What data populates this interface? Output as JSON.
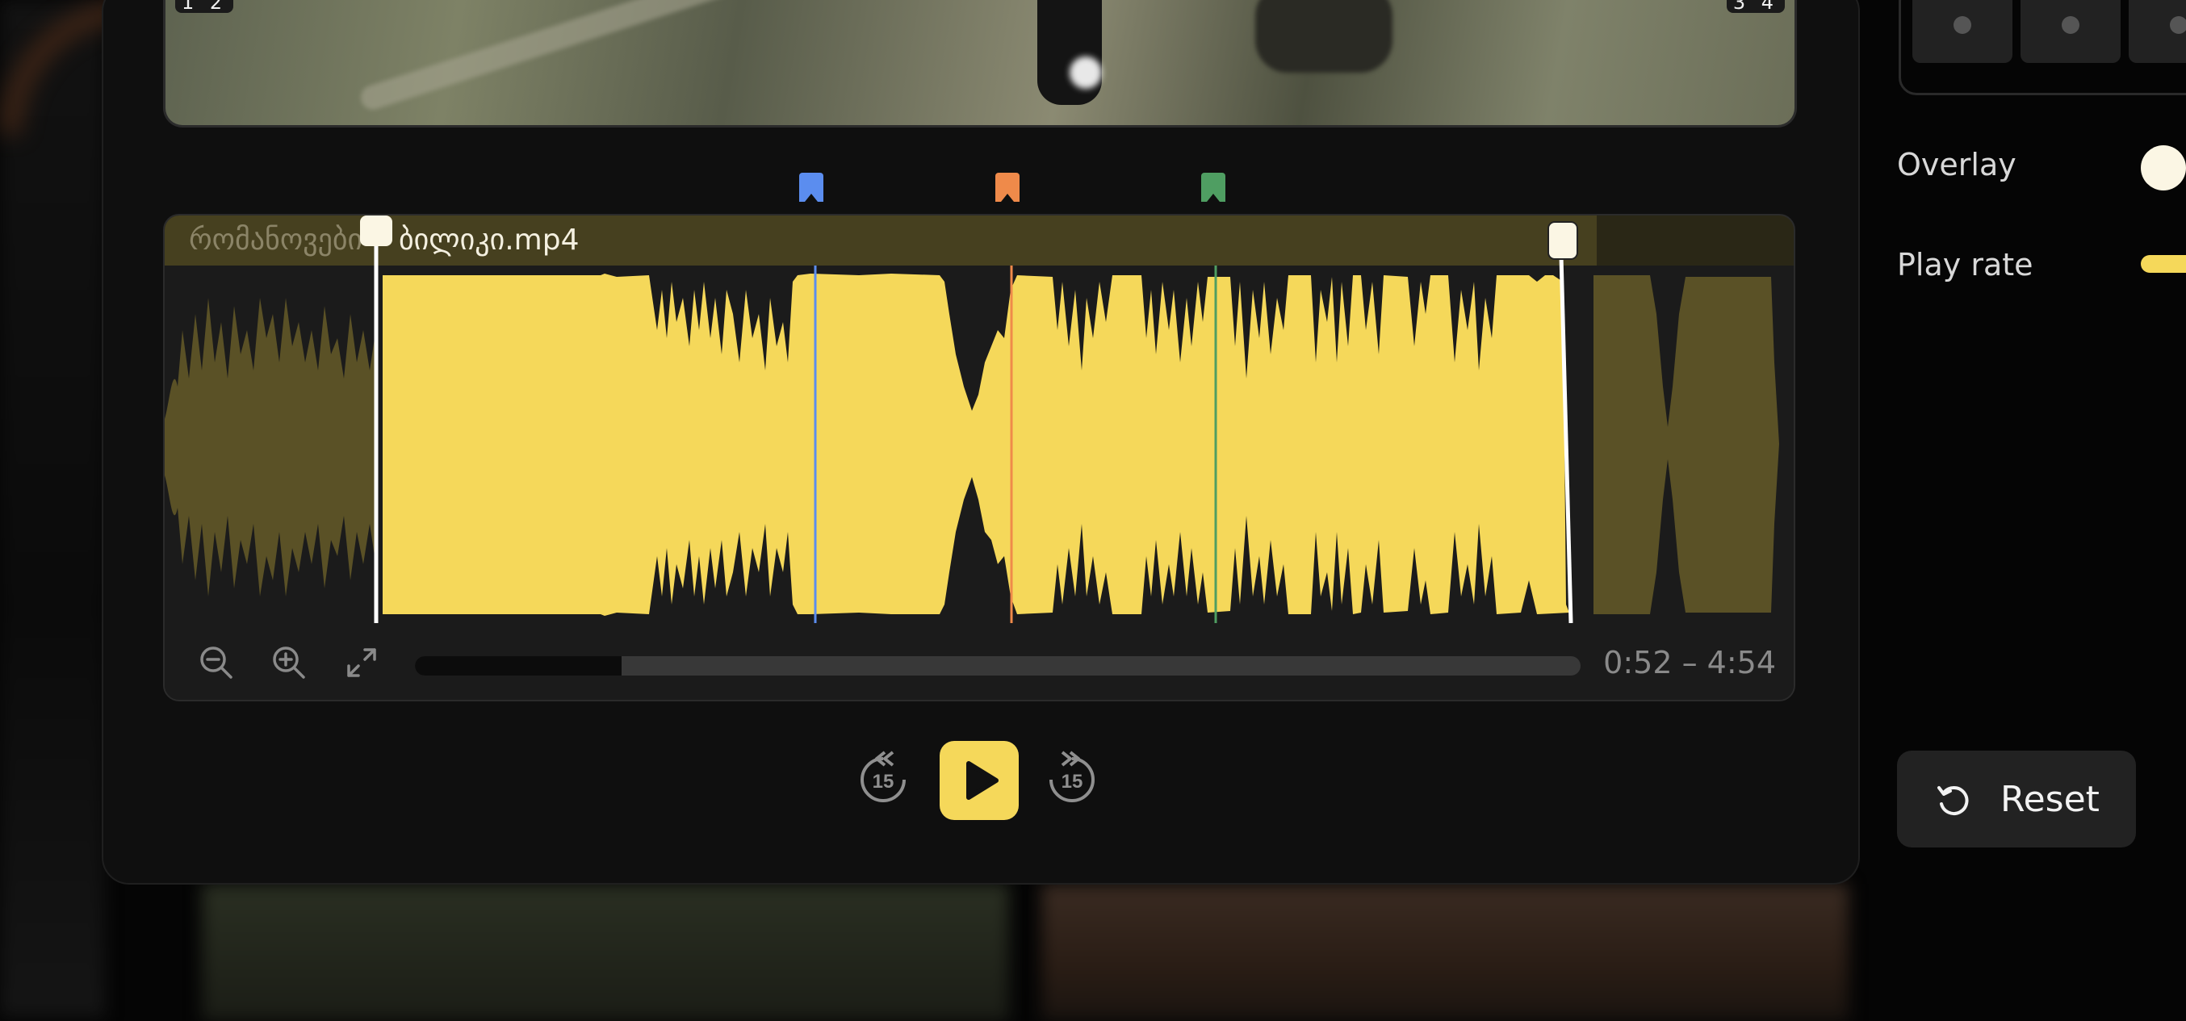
{
  "video": {
    "left_corner_label": "1 2",
    "right_corner_label": "3 4"
  },
  "markers": [
    {
      "name": "blue-marker",
      "color": "#5b8def"
    },
    {
      "name": "orange-marker",
      "color": "#ef8a4a"
    },
    {
      "name": "green-marker",
      "color": "#4f9e62"
    }
  ],
  "timeline": {
    "filename_faded": "რომანოვები",
    "filename_bright": "ბილიკი.mp4",
    "time_range": "0:52 – 4:54",
    "accent_color": "#f5d85a"
  },
  "toolbar": {
    "zoom_out_icon": "zoom-out-icon",
    "zoom_in_icon": "zoom-in-icon",
    "fit_icon": "expand-icon"
  },
  "playback": {
    "rewind_label": "15",
    "forward_label": "15"
  },
  "settings": {
    "overlay_label": "Overlay",
    "play_rate_label": "Play rate",
    "reset_label": "Reset"
  }
}
